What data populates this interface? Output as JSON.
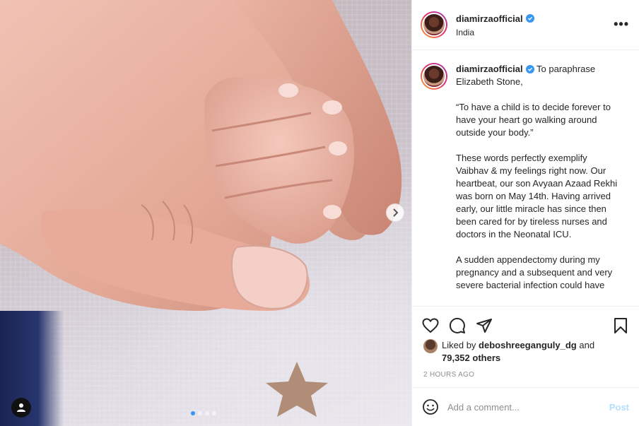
{
  "post": {
    "username": "diamirzaofficial",
    "location": "India",
    "more_label": "•••",
    "caption": {
      "username": "diamirzaofficial",
      "intro": "To paraphrase Elizabeth Stone,",
      "quote": "“To have a child is to decide forever to have your heart go walking around outside your body.”",
      "para2": "These words perfectly exemplify Vaibhav & my feelings right now. Our heartbeat, our son Avyaan Azaad Rekhi was born on May 14th. Having arrived early, our little miracle has since then been cared for by tireless nurses and doctors in the Neonatal ICU.",
      "para3": "A sudden appendectomy during my pregnancy and a subsequent and very severe bacterial infection could have"
    },
    "likes": {
      "prefix": "Liked by",
      "liker": "deboshreeganguly_dg",
      "conjunction": "and",
      "others": "79,352 others"
    },
    "timestamp": "2 HOURS AGO",
    "comment_placeholder": "Add a comment...",
    "post_label": "Post",
    "carousel": {
      "total_slides": 4,
      "active_slide": 1
    }
  },
  "icons": {
    "verified": "verified-badge-icon",
    "like": "heart-icon",
    "comment": "comment-icon",
    "share": "paper-plane-icon",
    "save": "bookmark-icon",
    "emoji": "smiley-icon",
    "next": "chevron-right-icon",
    "tags": "user-tag-icon"
  },
  "colors": {
    "accent": "#3897f0",
    "post_button_disabled": "#b2dffc",
    "secondary_text": "#8e8e8e"
  }
}
